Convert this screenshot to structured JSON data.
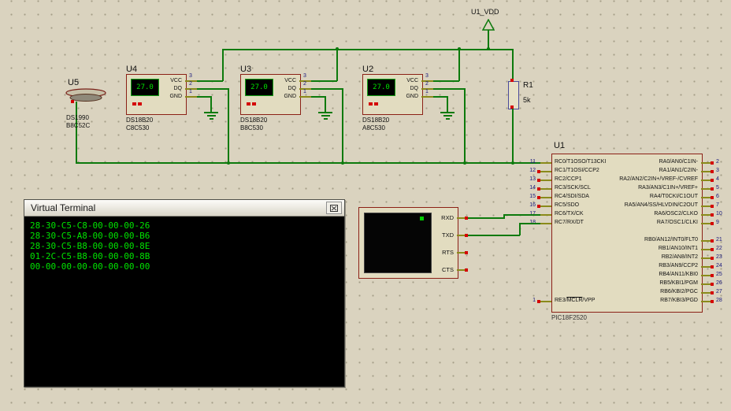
{
  "schematic": {
    "power_label": "U1_VDD",
    "resistor": {
      "ref": "R1",
      "value": "5k"
    },
    "ibutton": {
      "ref": "U5",
      "part": "DS1990",
      "serial": "B8C52C"
    },
    "sensors": [
      {
        "ref": "U4",
        "display": "27.0",
        "part": "DS18B20",
        "serial": "C8C530",
        "pin_names": [
          "VCC",
          "DQ",
          "GND"
        ],
        "pin_numbers": [
          "3",
          "2",
          "1"
        ]
      },
      {
        "ref": "U3",
        "display": "27.0",
        "part": "DS18B20",
        "serial": "B8C530",
        "pin_names": [
          "VCC",
          "DQ",
          "GND"
        ],
        "pin_numbers": [
          "3",
          "2",
          "1"
        ]
      },
      {
        "ref": "U2",
        "display": "27.0",
        "part": "DS18B20",
        "serial": "A8C530",
        "pin_names": [
          "VCC",
          "DQ",
          "GND"
        ],
        "pin_numbers": [
          "3",
          "2",
          "1"
        ]
      }
    ],
    "mcu": {
      "ref": "U1",
      "part": "PIC18F2520",
      "left_pins": [
        {
          "num": "11",
          "label": "RC0/T1OSO/T13CKI"
        },
        {
          "num": "12",
          "label": "RC1/T1OSI/CCP2"
        },
        {
          "num": "13",
          "label": "RC2/CCP1"
        },
        {
          "num": "14",
          "label": "RC3/SCK/SCL"
        },
        {
          "num": "15",
          "label": "RC4/SDI/SDA"
        },
        {
          "num": "16",
          "label": "RC5/SDO"
        },
        {
          "num": "17",
          "label": "RC6/TX/CK"
        },
        {
          "num": "18",
          "label": "RC7/RX/DT"
        }
      ],
      "mclr_pin": {
        "num": "1",
        "prefix": "RE3/",
        "overline": "MCLR",
        "suffix": "/VPP"
      },
      "right_pins_a": [
        {
          "num": "2",
          "label": "RA0/AN0/C1IN-"
        },
        {
          "num": "3",
          "label": "RA1/AN1/C2IN-"
        },
        {
          "num": "4",
          "label": "RA2/AN2/C2IN+/VREF-/CVREF"
        },
        {
          "num": "5",
          "label": "RA3/AN3/C1IN+/VREF+"
        },
        {
          "num": "6",
          "label": "RA4/T0CKI/C1OUT"
        },
        {
          "num": "7",
          "label": "RA5/AN4/SS/HLVDIN/C2OUT"
        },
        {
          "num": "10",
          "label": "RA6/OSC2/CLKO"
        },
        {
          "num": "9",
          "label": "RA7/OSC1/CLKI"
        }
      ],
      "right_pins_b": [
        {
          "num": "21",
          "label": "RB0/AN12/INT0/FLT0"
        },
        {
          "num": "22",
          "label": "RB1/AN10/INT1"
        },
        {
          "num": "23",
          "label": "RB2/AN8/INT2"
        },
        {
          "num": "24",
          "label": "RB3/AN9/CCP2"
        },
        {
          "num": "25",
          "label": "RB4/AN11/KBI0"
        },
        {
          "num": "26",
          "label": "RB5/KBI1/PGM"
        },
        {
          "num": "27",
          "label": "RB6/KBI2/PGC"
        },
        {
          "num": "28",
          "label": "RB7/KBI3/PGD"
        }
      ]
    },
    "vterm": {
      "pins": [
        "RXD",
        "TXD",
        "RTS",
        "CTS"
      ]
    }
  },
  "terminal_window": {
    "title": "Virtual Terminal",
    "lines": [
      "28-30-C5-C8-00-00-00-26",
      "28-30-C5-A8-00-00-00-B6",
      "28-30-C5-B8-00-00-00-8E",
      "01-2C-C5-B8-00-00-00-8B",
      "00-00-00-00-00-00-00-00"
    ]
  },
  "colors": {
    "wire": "#0c7a0c",
    "pin": "#8a8a1a",
    "component_border": "#8b2016",
    "unconnected_marker": "#d40000",
    "terminal_text": "#00e400",
    "display_text": "#00e000"
  }
}
